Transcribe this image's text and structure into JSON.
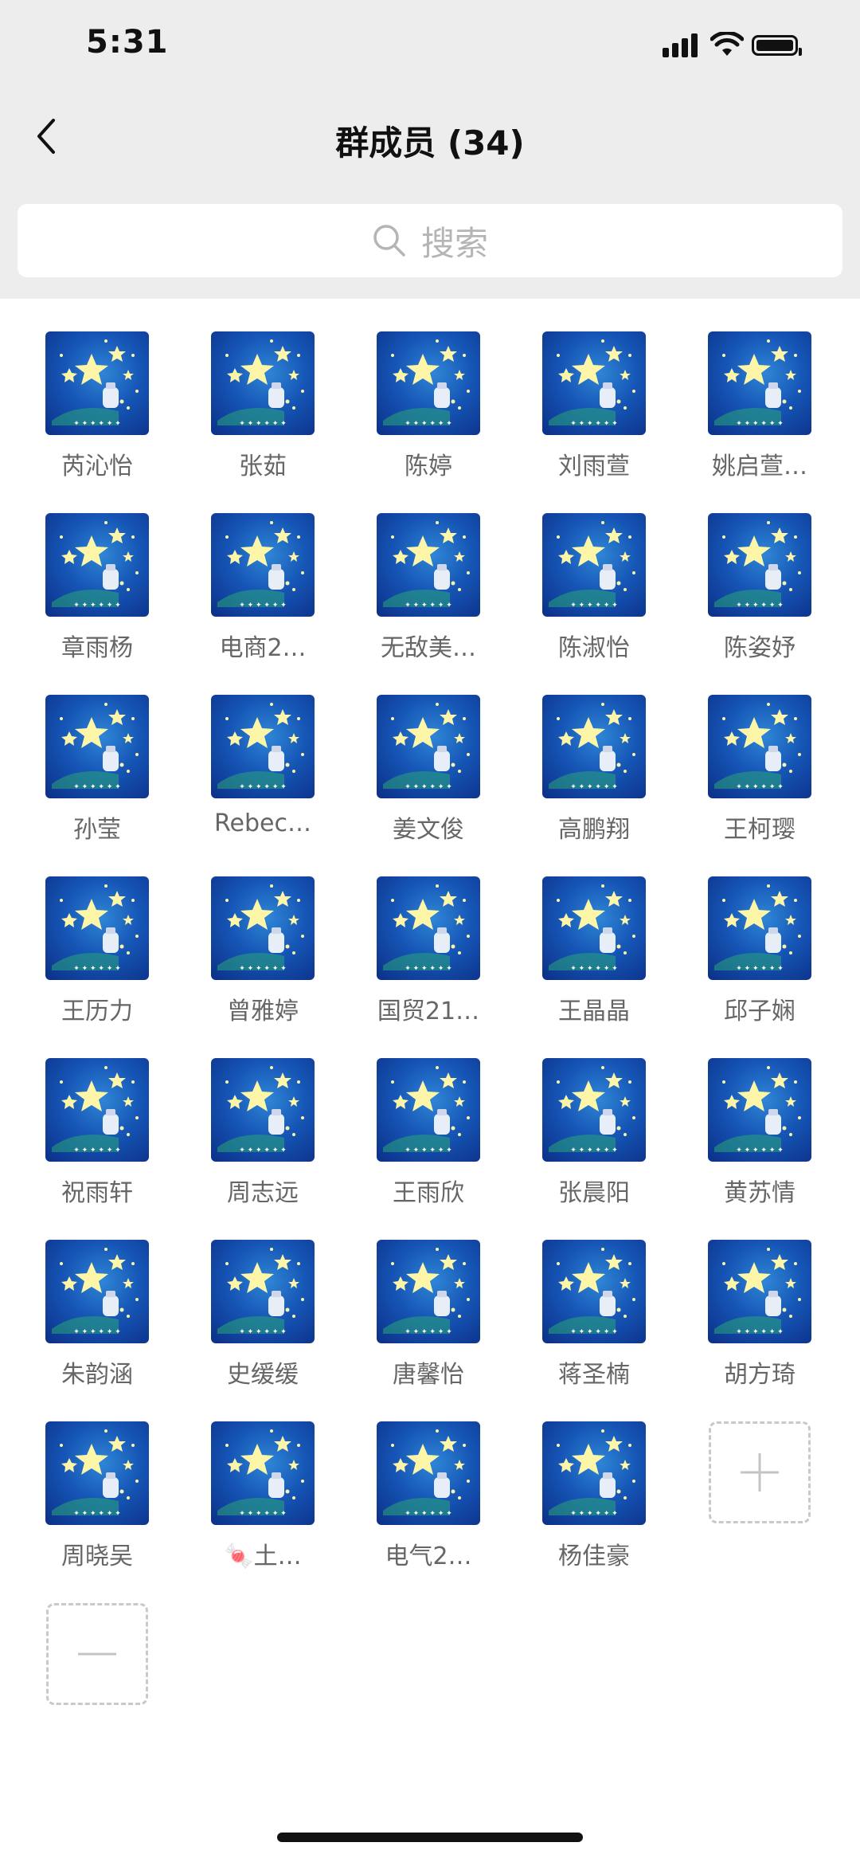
{
  "status": {
    "time": "5:31"
  },
  "header": {
    "title": "群成员 (34)"
  },
  "search": {
    "placeholder": "搜索"
  },
  "members": [
    "芮沁怡",
    "张茹",
    "陈婷",
    "刘雨萱",
    "姚启萱…",
    "章雨杨",
    "电商2…",
    "无敌美…",
    "陈淑怡",
    "陈姿妤",
    "孙莹",
    "Rebec…",
    "姜文俊",
    "高鹏翔",
    "王柯璎",
    "王历力",
    "曾雅婷",
    "国贸21…",
    "王晶晶",
    "邱子娴",
    "祝雨轩",
    "周志远",
    "王雨欣",
    "张晨阳",
    "黄苏情",
    "朱韵涵",
    "史缓缓",
    "唐馨怡",
    "蒋圣楠",
    "胡方琦",
    "周晓吴",
    "🍬土…",
    "电气2…",
    "杨佳豪"
  ],
  "actions": {
    "add": "add-member",
    "remove": "remove-member"
  },
  "colors": {
    "accent_bg": "#ededed",
    "avatar": "#1656b6"
  }
}
